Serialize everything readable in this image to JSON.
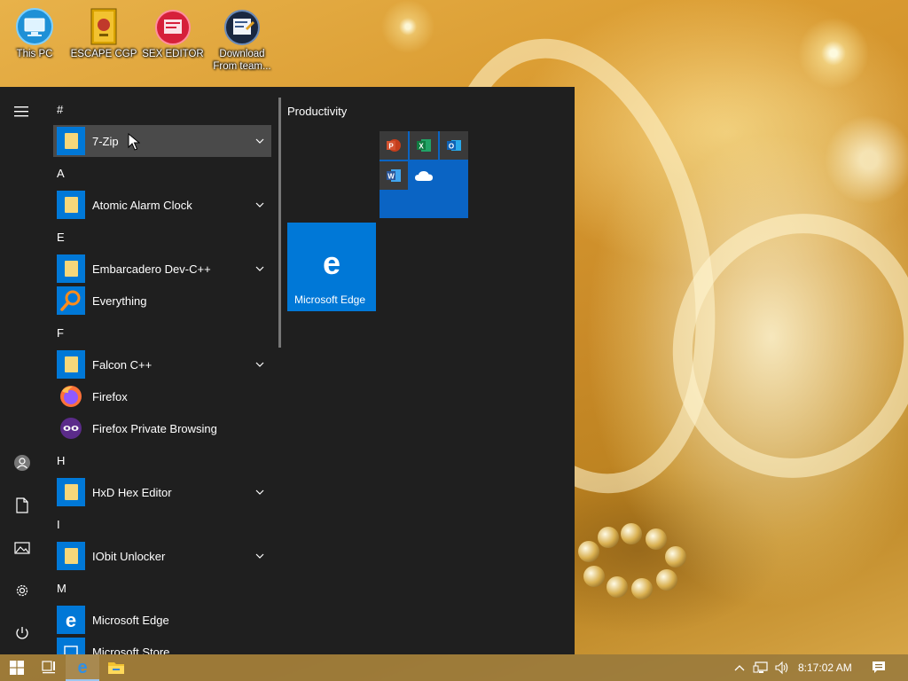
{
  "desktop": {
    "icons": [
      {
        "label": "This PC",
        "icon": "monitor-icon"
      },
      {
        "label": "ESCAPE CGP",
        "icon": "book-icon"
      },
      {
        "label": "SEX EDITOR",
        "icon": "editor-icon"
      },
      {
        "label": "Download From team...",
        "icon": "download-icon"
      }
    ]
  },
  "start_menu": {
    "letters": [
      "#",
      "A",
      "E",
      "F",
      "H",
      "I",
      "M"
    ],
    "apps": [
      {
        "name": "7-Zip",
        "icon": "folder-icon",
        "expandable": true
      },
      {
        "name": "Atomic Alarm Clock",
        "icon": "folder-icon",
        "expandable": true
      },
      {
        "name": "Embarcadero Dev-C++",
        "icon": "folder-icon",
        "expandable": true
      },
      {
        "name": "Everything",
        "icon": "search-icon",
        "expandable": false
      },
      {
        "name": "Falcon C++",
        "icon": "folder-icon",
        "expandable": true
      },
      {
        "name": "Firefox",
        "icon": "firefox-icon",
        "expandable": false
      },
      {
        "name": "Firefox Private Browsing",
        "icon": "private-browsing-icon",
        "expandable": false
      },
      {
        "name": "HxD Hex Editor",
        "icon": "folder-icon",
        "expandable": true
      },
      {
        "name": "IObit Unlocker",
        "icon": "folder-icon",
        "expandable": true
      },
      {
        "name": "Microsoft Edge",
        "icon": "edge-icon",
        "expandable": false
      },
      {
        "name": "Microsoft Store",
        "icon": "store-icon",
        "expandable": false
      }
    ],
    "tiles": {
      "group_title": "Productivity",
      "office_apps": [
        {
          "label": "P",
          "icon": "powerpoint-icon",
          "color": "#c43e1c"
        },
        {
          "label": "X",
          "icon": "excel-icon",
          "color": "#1d6f42"
        },
        {
          "label": "O",
          "icon": "outlook-icon",
          "color": "#0f62b5"
        },
        {
          "label": "W",
          "icon": "word-icon",
          "color": "#2b579a"
        },
        {
          "label": "",
          "icon": "onedrive-icon",
          "color": "#0a64c4"
        }
      ],
      "edge_tile": {
        "label": "Microsoft Edge",
        "color": "#0078d7"
      }
    }
  },
  "taskbar": {
    "clock": "8:17:02 AM"
  },
  "colors": {
    "accent": "#0078d7",
    "menu_bg": "#1f1f1f",
    "hover_bg": "#4a4a4a"
  }
}
